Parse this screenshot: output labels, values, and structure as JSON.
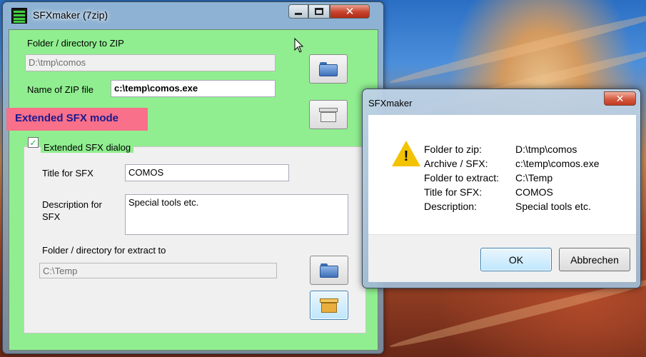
{
  "main_window": {
    "title": "SFXmaker (7zip)",
    "folder_label": "Folder / directory to ZIP",
    "folder_value": "D:\\tmp\\comos",
    "zip_label": "Name of ZIP file",
    "zip_value": "c:\\temp\\comos.exe",
    "mode_banner": "Extended SFX mode",
    "ext_dialog_label": "Extended SFX dialog",
    "ext_dialog_checked": true,
    "title_label": "Title for SFX",
    "title_value": "COMOS",
    "desc_label_line1": "Description for",
    "desc_label_line2": "SFX",
    "desc_value": "Special tools etc.",
    "extract_label": "Folder / directory for extract to",
    "extract_value": "C:\\Temp",
    "close_glyph": "✕"
  },
  "dialog": {
    "title": "SFXmaker",
    "rows": [
      {
        "key": "Folder to zip:",
        "value": "D:\\tmp\\comos"
      },
      {
        "key": "Archive / SFX:",
        "value": "c:\\temp\\comos.exe"
      },
      {
        "key": "Folder to extract:",
        "value": "C:\\Temp"
      },
      {
        "key": "Title for SFX:",
        "value": "COMOS"
      },
      {
        "key": "Description:",
        "value": "Special tools etc."
      }
    ],
    "ok_label": "OK",
    "cancel_label": "Abbrechen",
    "close_glyph": "✕",
    "warn_glyph": "!"
  }
}
